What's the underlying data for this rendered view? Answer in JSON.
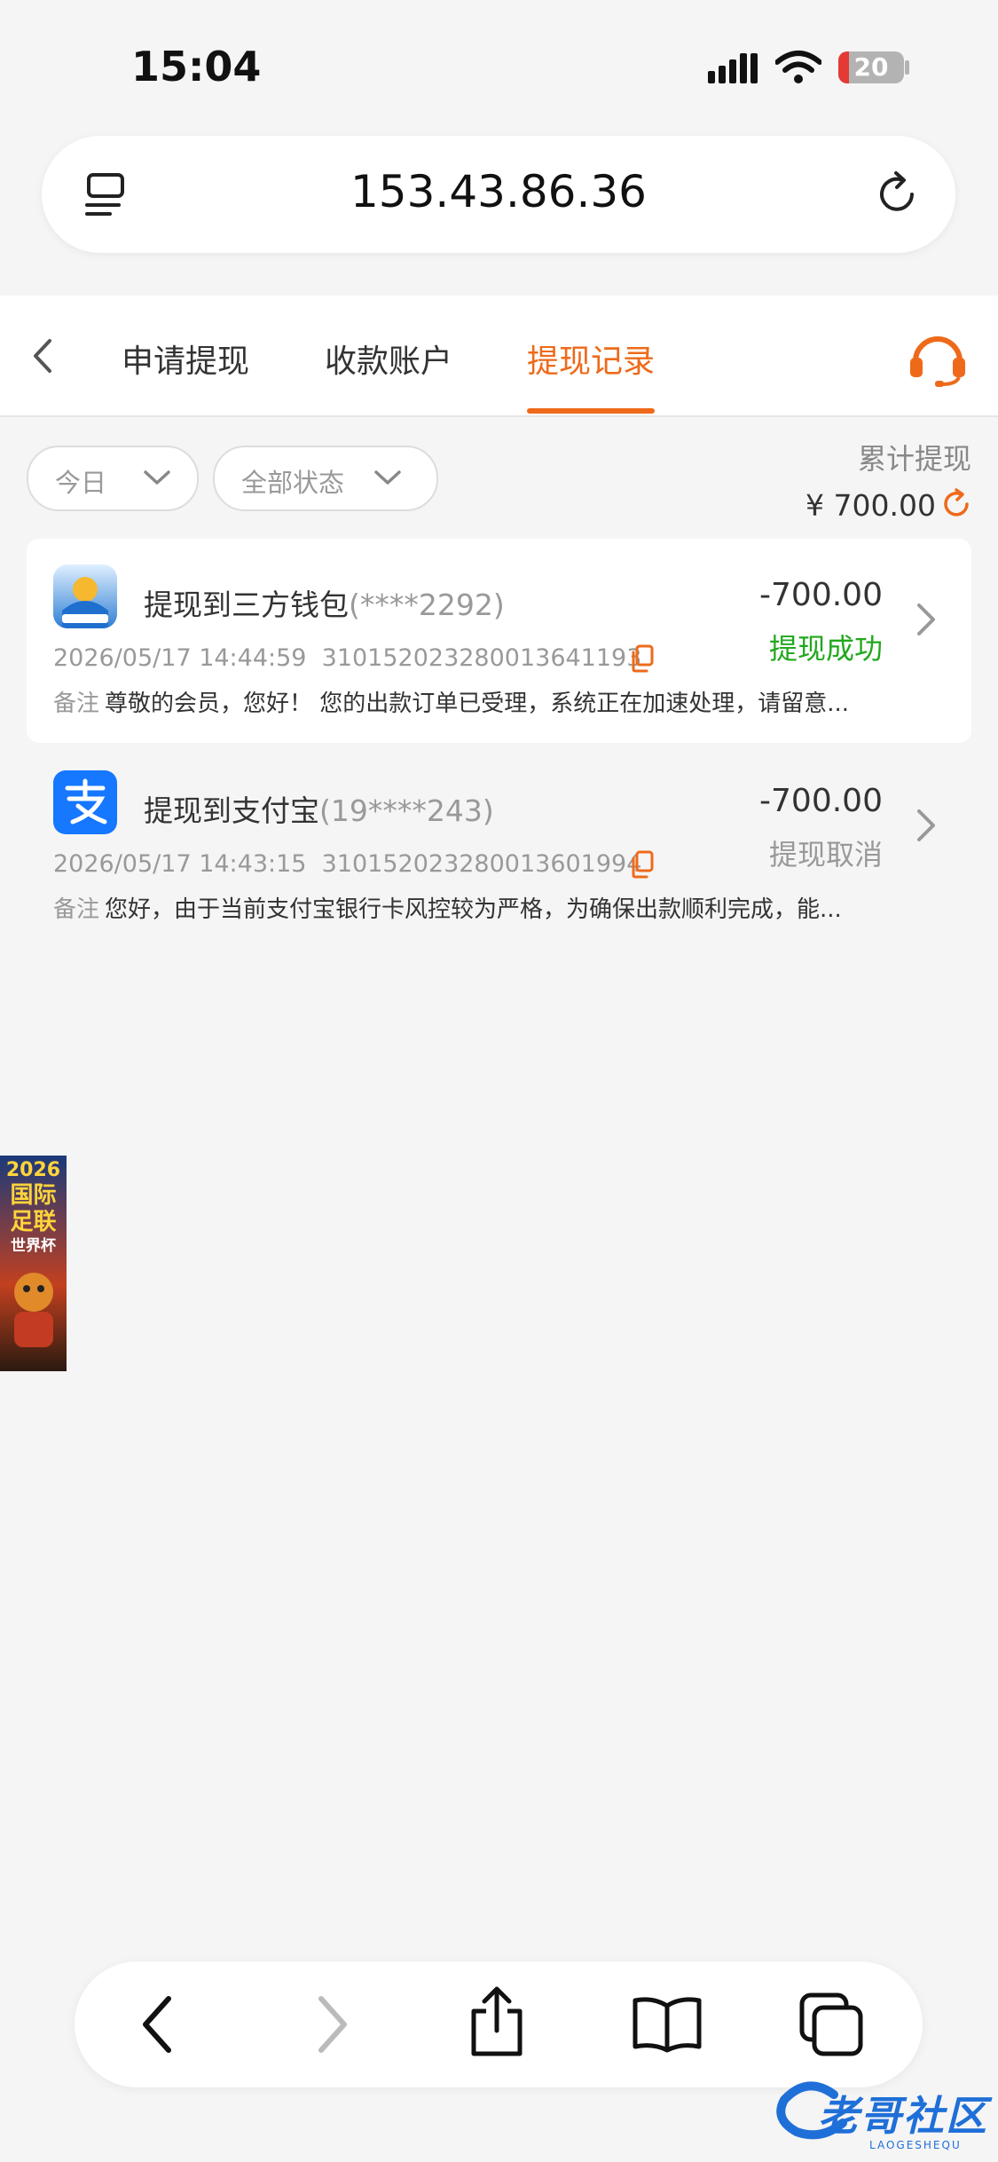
{
  "status_bar": {
    "time": "15:04",
    "battery": "20"
  },
  "browser": {
    "url": "153.43.86.36"
  },
  "header": {
    "tabs": [
      {
        "label": "申请提现"
      },
      {
        "label": "收款账户"
      },
      {
        "label": "提现记录"
      }
    ],
    "active_tab": "提现记录"
  },
  "filters": {
    "date": "今日",
    "status": "全部状态"
  },
  "total": {
    "label": "累计提现",
    "amount": "¥ 700.00"
  },
  "records": [
    {
      "title": "提现到三方钱包",
      "account": "(****2292)",
      "amount": "-700.00",
      "status": "提现成功",
      "datetime": "2026/05/17 14:44:59",
      "order_no": "3101520232800136411​93",
      "note_label": "备注",
      "note": "尊敬的会员，您好！ 您的出款订单已受理，系统正在加速处理，请留意...",
      "icon": "wallet-app-icon",
      "status_color": "#22a81e"
    },
    {
      "title": "提现到支付宝",
      "account": "(19****243)",
      "amount": "-700.00",
      "status": "提现取消",
      "datetime": "2026/05/17 14:43:15",
      "order_no": "310152023280013601994",
      "note_label": "备注",
      "note": "您好，由于当前支付宝银行卡风控较为严格，为确保出款顺利完成，能...",
      "icon": "alipay-icon",
      "status_color": "#999999"
    }
  ],
  "side_banner": {
    "lines": [
      "2026",
      "国际",
      "足联",
      "世界杯"
    ]
  },
  "watermark": {
    "text": "老哥社区",
    "sub": "LAOGESHEQU"
  },
  "colors": {
    "accent": "#ee6a1a",
    "success": "#22a81e",
    "background": "#f5f5f5"
  }
}
